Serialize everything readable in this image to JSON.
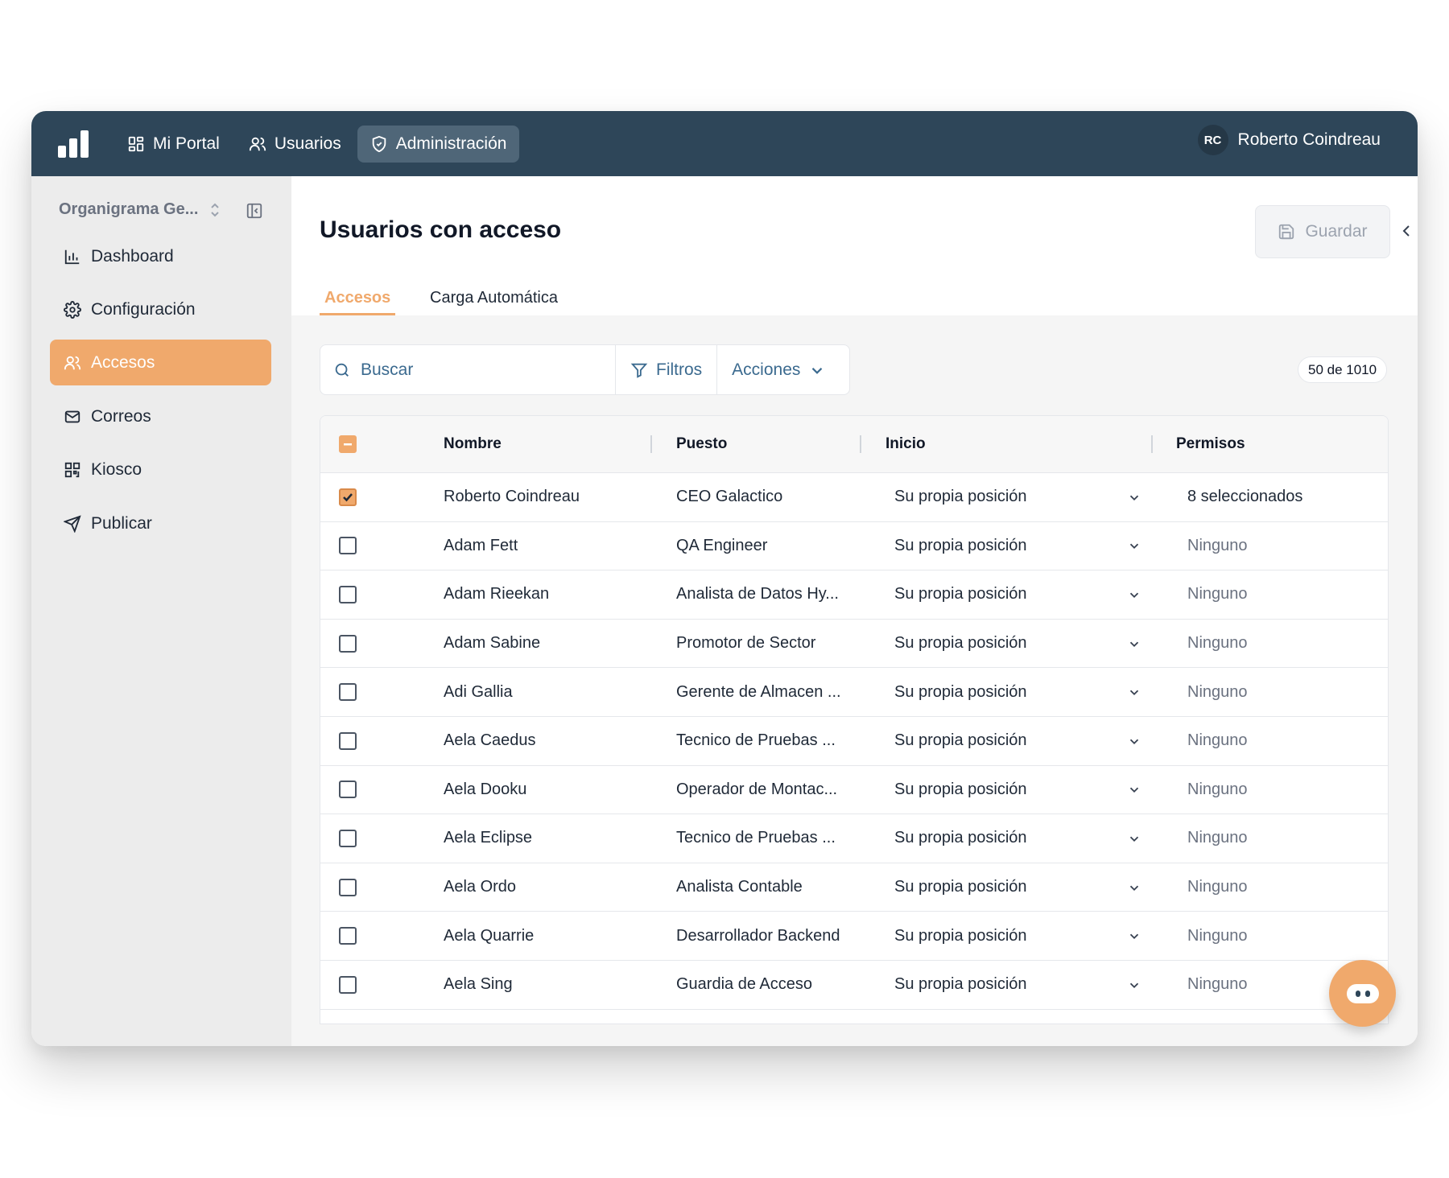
{
  "topbar": {
    "nav": [
      {
        "label": "Mi Portal",
        "icon": "grid-icon"
      },
      {
        "label": "Usuarios",
        "icon": "users-icon"
      },
      {
        "label": "Administración",
        "icon": "shield-icon",
        "active": true
      }
    ],
    "user": {
      "initials": "RC",
      "name": "Roberto Coindreau"
    }
  },
  "sidebar": {
    "org_name": "Organigrama Ge...",
    "items": [
      {
        "label": "Dashboard",
        "icon": "bar-chart-icon"
      },
      {
        "label": "Configuración",
        "icon": "gear-icon"
      },
      {
        "label": "Accesos",
        "icon": "users-icon",
        "active": true
      },
      {
        "label": "Correos",
        "icon": "mail-icon"
      },
      {
        "label": "Kiosco",
        "icon": "qr-icon"
      },
      {
        "label": "Publicar",
        "icon": "send-icon"
      }
    ]
  },
  "main": {
    "title": "Usuarios con acceso",
    "save_label": "Guardar",
    "tabs": [
      {
        "label": "Accesos",
        "active": true
      },
      {
        "label": "Carga Automática"
      }
    ],
    "search": {
      "placeholder": "Buscar",
      "value": ""
    },
    "filters_label": "Filtros",
    "actions_label": "Acciones",
    "count": "50 de 1010"
  },
  "table": {
    "headers": {
      "name": "Nombre",
      "puesto": "Puesto",
      "inicio": "Inicio",
      "permisos": "Permisos"
    },
    "rows": [
      {
        "checked": true,
        "name": "Roberto Coindreau",
        "puesto": "CEO Galactico",
        "inicio": "Su propia posición",
        "permisos": "8 seleccionados"
      },
      {
        "checked": false,
        "name": "Adam Fett",
        "puesto": "QA Engineer",
        "inicio": "Su propia posición",
        "permisos": "Ninguno"
      },
      {
        "checked": false,
        "name": "Adam Rieekan",
        "puesto": "Analista de Datos Hy...",
        "inicio": "Su propia posición",
        "permisos": "Ninguno"
      },
      {
        "checked": false,
        "name": "Adam Sabine",
        "puesto": "Promotor de Sector",
        "inicio": "Su propia posición",
        "permisos": "Ninguno"
      },
      {
        "checked": false,
        "name": "Adi Gallia",
        "puesto": "Gerente de Almacen ...",
        "inicio": "Su propia posición",
        "permisos": "Ninguno"
      },
      {
        "checked": false,
        "name": "Aela Caedus",
        "puesto": "Tecnico de Pruebas ...",
        "inicio": "Su propia posición",
        "permisos": "Ninguno"
      },
      {
        "checked": false,
        "name": "Aela Dooku",
        "puesto": "Operador de Montac...",
        "inicio": "Su propia posición",
        "permisos": "Ninguno"
      },
      {
        "checked": false,
        "name": "Aela Eclipse",
        "puesto": "Tecnico de Pruebas ...",
        "inicio": "Su propia posición",
        "permisos": "Ninguno"
      },
      {
        "checked": false,
        "name": "Aela Ordo",
        "puesto": "Analista Contable",
        "inicio": "Su propia posición",
        "permisos": "Ninguno"
      },
      {
        "checked": false,
        "name": "Aela Quarrie",
        "puesto": "Desarrollador Backend",
        "inicio": "Su propia posición",
        "permisos": "Ninguno"
      },
      {
        "checked": false,
        "name": "Aela Sing",
        "puesto": "Guardia de Acceso",
        "inicio": "Su propia posición",
        "permisos": "Ninguno"
      }
    ]
  },
  "colors": {
    "topbar": "#2e4659",
    "accent": "#f0a96c",
    "link": "#3b6a8f"
  }
}
